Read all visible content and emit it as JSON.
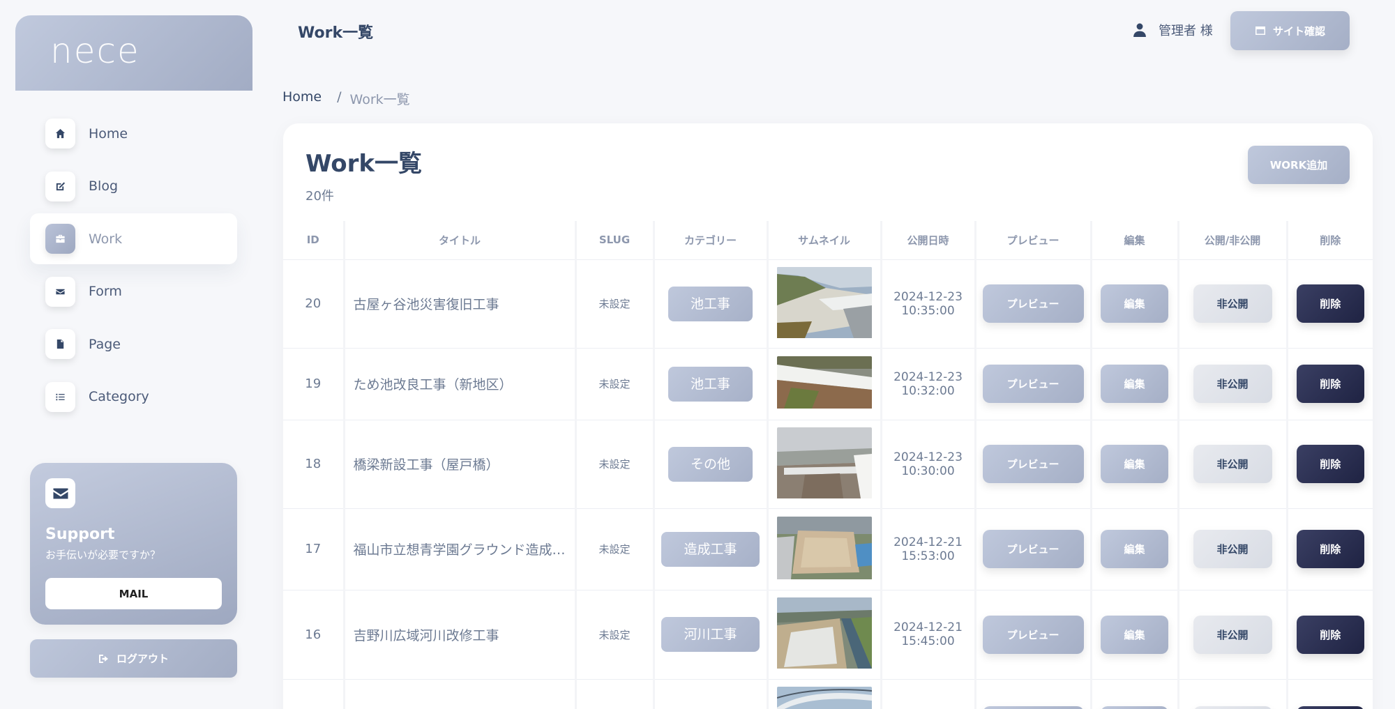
{
  "brand": {
    "logo_text": "nece"
  },
  "sidebar": {
    "items": [
      {
        "label": "Home",
        "icon": "home-icon",
        "active": false
      },
      {
        "label": "Blog",
        "icon": "edit-icon",
        "active": false
      },
      {
        "label": "Work",
        "icon": "briefcase-icon",
        "active": true
      },
      {
        "label": "Form",
        "icon": "envelope-icon",
        "active": false
      },
      {
        "label": "Page",
        "icon": "file-icon",
        "active": false
      },
      {
        "label": "Category",
        "icon": "list-icon",
        "active": false
      }
    ]
  },
  "support": {
    "title": "Support",
    "subtitle": "お手伝いが必要ですか？",
    "mail_label": "MAIL"
  },
  "logout_label": "ログアウト",
  "header": {
    "title": "Work一覧",
    "user_label": "管理者 様",
    "site_button": "サイト確認"
  },
  "breadcrumb": {
    "home": "Home",
    "separator": "/",
    "current": "Work一覧"
  },
  "card": {
    "title": "Work一覧",
    "count": "20件",
    "add_button": "WORK追加"
  },
  "table": {
    "columns": [
      "ID",
      "タイトル",
      "SLUG",
      "カテゴリー",
      "サムネイル",
      "公開日時",
      "プレビュー",
      "編集",
      "公開/非公開",
      "削除"
    ],
    "button_labels": {
      "preview": "プレビュー",
      "edit": "編集",
      "toggle": "非公開",
      "delete": "削除"
    },
    "rows": [
      {
        "id": "20",
        "title": "古屋ヶ谷池災害復旧工事",
        "slug": "未設定",
        "category": "池工事",
        "date": "2024-12-23",
        "time": "10:35:00",
        "thumb": "pond-slope"
      },
      {
        "id": "19",
        "title": "ため池改良工事（新地区）",
        "slug": "未設定",
        "category": "池工事",
        "date": "2024-12-23",
        "time": "10:32:00",
        "thumb": "pond-bank"
      },
      {
        "id": "18",
        "title": "橋梁新設工事（屋戸橋）",
        "slug": "未設定",
        "category": "その他",
        "date": "2024-12-23",
        "time": "10:30:00",
        "thumb": "bridge"
      },
      {
        "id": "17",
        "title": "福山市立想青学園グラウンド造成…",
        "slug": "未設定",
        "category": "造成工事",
        "date": "2024-12-21",
        "time": "15:53:00",
        "thumb": "ground-aerial"
      },
      {
        "id": "16",
        "title": "吉野川広域河川改修工事",
        "slug": "未設定",
        "category": "河川工事",
        "date": "2024-12-21",
        "time": "15:45:00",
        "thumb": "river-aerial"
      }
    ]
  },
  "colors": {
    "accent_gradient_start": "#bfc8dc",
    "accent_gradient_end": "#a5afc6",
    "delete_button": "#2a2e50",
    "text_dark": "#344767",
    "text_muted": "#8d97ad"
  }
}
